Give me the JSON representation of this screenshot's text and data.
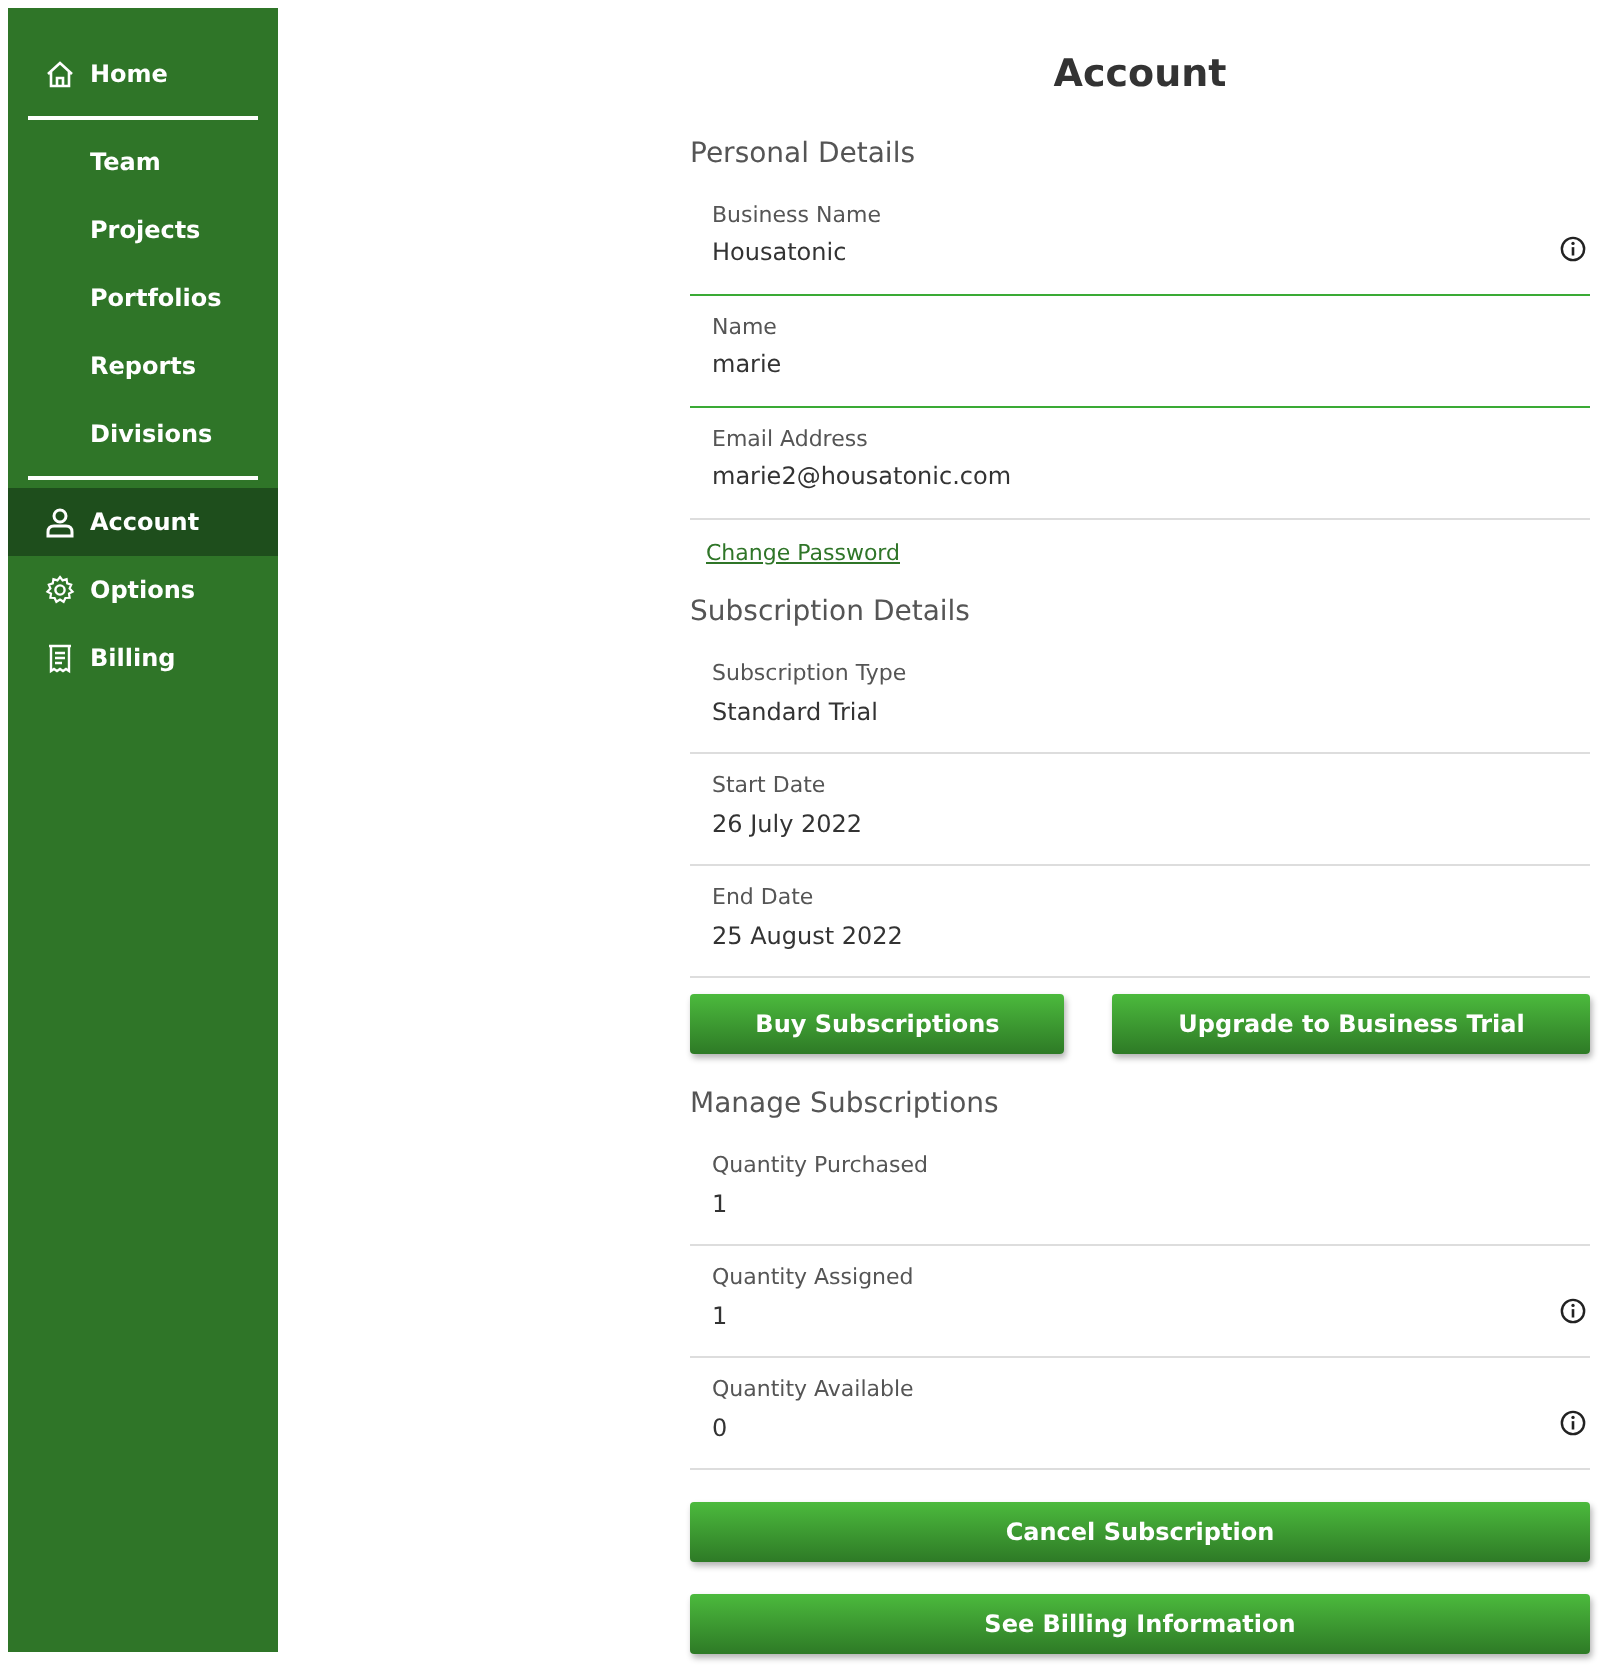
{
  "sidebar": {
    "items": [
      {
        "label": "Home",
        "kind": "main",
        "selected": false
      },
      {
        "label": "Team",
        "kind": "sub",
        "selected": false
      },
      {
        "label": "Projects",
        "kind": "sub",
        "selected": false
      },
      {
        "label": "Portfolios",
        "kind": "sub",
        "selected": false
      },
      {
        "label": "Reports",
        "kind": "sub",
        "selected": false
      },
      {
        "label": "Divisions",
        "kind": "sub",
        "selected": false
      },
      {
        "label": "Account",
        "kind": "main",
        "selected": true
      },
      {
        "label": "Options",
        "kind": "main",
        "selected": false
      },
      {
        "label": "Billing",
        "kind": "main",
        "selected": false
      }
    ]
  },
  "title": "Account",
  "sections": [
    {
      "heading": "Personal Details",
      "fields": [
        {
          "label": "Business Name",
          "value": "Housatonic",
          "editable": true,
          "info": true
        },
        {
          "label": "Name",
          "value": "marie",
          "editable": true,
          "info": false
        },
        {
          "label": "Email Address",
          "value": "marie2@housatonic.com",
          "editable": false,
          "info": false
        }
      ],
      "link": "Change Password"
    },
    {
      "heading": "Subscription Details",
      "fields": [
        {
          "label": "Subscription Type",
          "value": "Standard Trial",
          "editable": false,
          "info": false
        },
        {
          "label": "Start Date",
          "value": "26 July 2022",
          "editable": false,
          "info": false
        },
        {
          "label": "End Date",
          "value": "25 August 2022",
          "editable": false,
          "info": false
        }
      ],
      "buttons": [
        "Buy Subscriptions",
        "Upgrade to Business Trial"
      ]
    },
    {
      "heading": "Manage Subscriptions",
      "fields": [
        {
          "label": "Quantity Purchased",
          "value": "1",
          "editable": false,
          "info": false
        },
        {
          "label": "Quantity Assigned",
          "value": "1",
          "editable": false,
          "info": true
        },
        {
          "label": "Quantity Available",
          "value": "0",
          "editable": false,
          "info": true
        }
      ],
      "buttons": [
        "Cancel Subscription",
        "See Billing Information"
      ]
    }
  ]
}
